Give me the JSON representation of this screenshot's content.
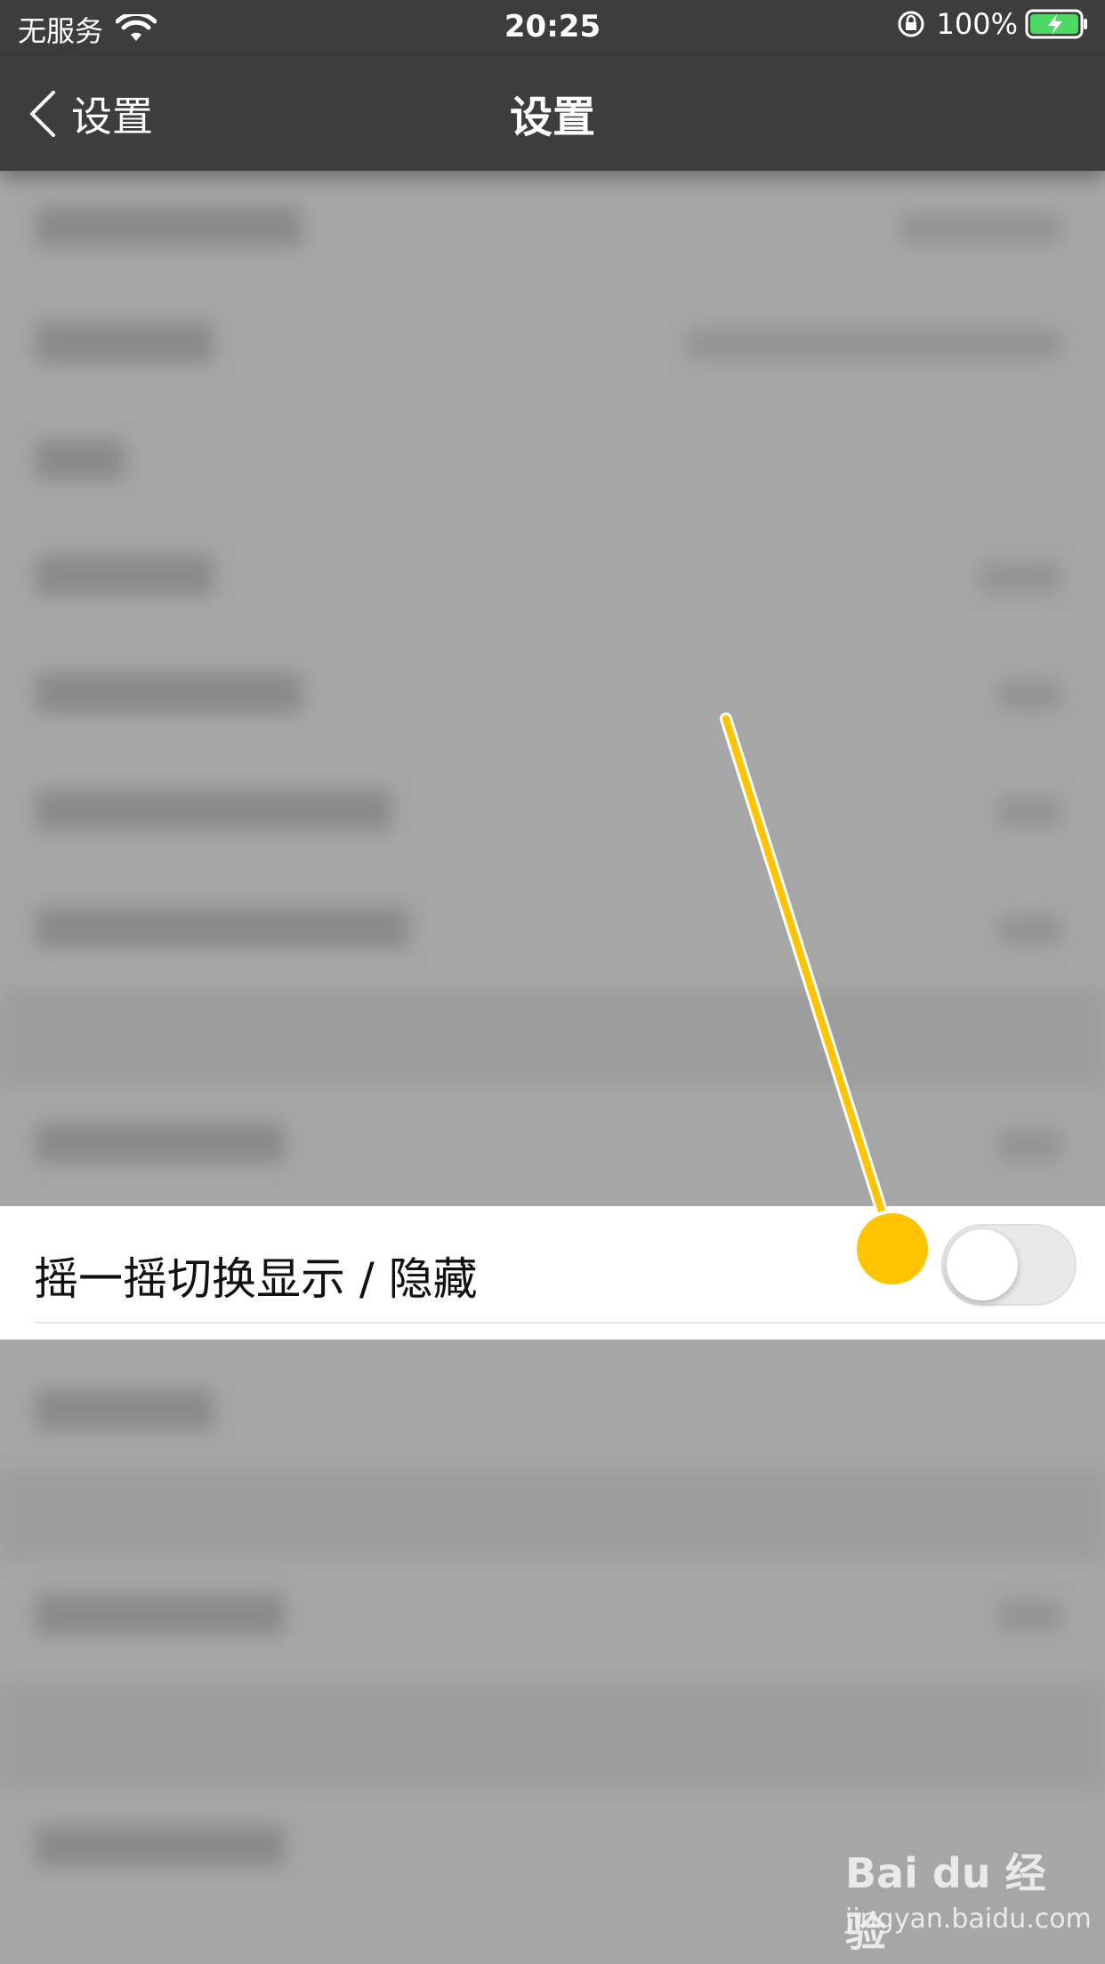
{
  "status_bar": {
    "carrier": "无服务",
    "time": "20:25",
    "battery": "100%",
    "icons": [
      "wifi-icon",
      "orientation-lock-icon",
      "battery-charging-icon"
    ]
  },
  "nav": {
    "back_label": "设置",
    "title": "设置"
  },
  "highlight_row": {
    "label": "摇一摇切换显示 / 隐藏",
    "toggle_on": false
  },
  "watermark": {
    "logo": "Bai du 经验",
    "url": "jingyan.baidu.com"
  },
  "colors": {
    "bar": "#3d3d3d",
    "overlay": "#a6a6a6",
    "pointer": "#ffc400"
  }
}
